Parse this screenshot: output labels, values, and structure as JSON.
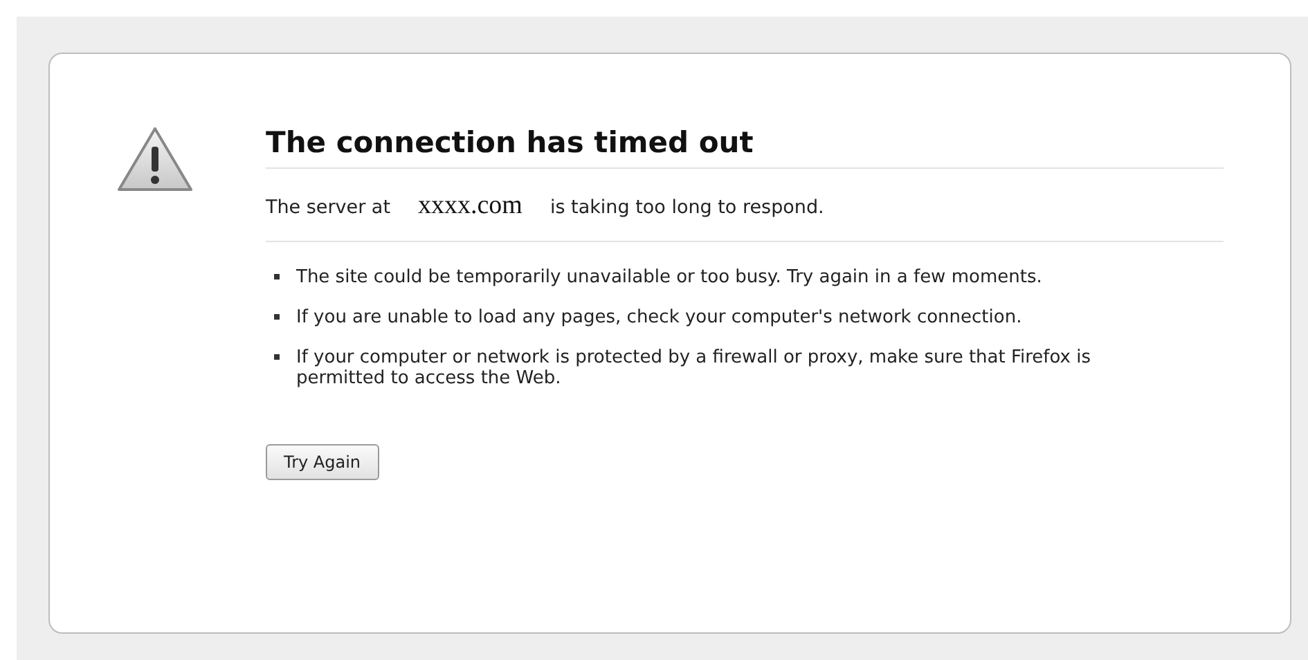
{
  "title": "The connection has timed out",
  "message": {
    "prefix": "The server at",
    "host": "xxxx.com",
    "suffix": "is taking too long to respond."
  },
  "bullets": [
    "The site could be temporarily unavailable or too busy. Try again in a few moments.",
    "If you are unable to load any pages, check your computer's network connection.",
    "If your computer or network is protected by a firewall or proxy, make sure that Firefox is permitted to access the Web."
  ],
  "button": "Try Again"
}
